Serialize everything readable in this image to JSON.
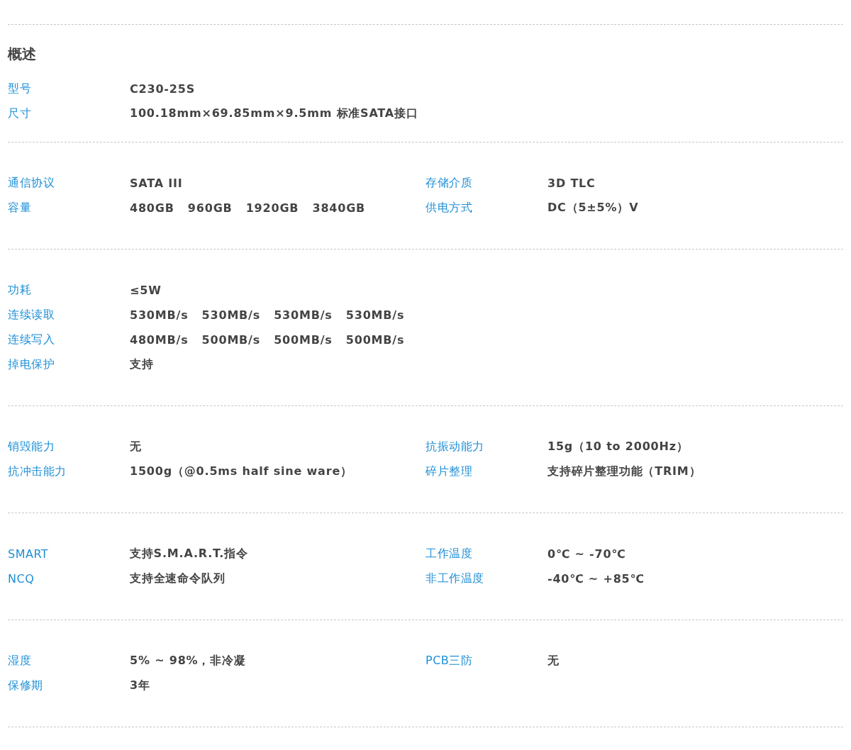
{
  "heading": "概述",
  "sections": [
    {
      "rows": [
        [
          {
            "label": "型号",
            "value": "C230-25S"
          }
        ],
        [
          {
            "label": "尺寸",
            "value": "100.18mm×69.85mm×9.5mm 标准SATA接口"
          }
        ]
      ]
    },
    {
      "rows": [
        [
          {
            "label": "通信协议",
            "value": "SATA III"
          },
          {
            "label": "存储介质",
            "value": "3D TLC"
          }
        ],
        [
          {
            "label": "容量",
            "value": "480GB   960GB   1920GB   3840GB"
          },
          {
            "label": "供电方式",
            "value": "DC（5±5%）V"
          }
        ]
      ]
    },
    {
      "rows": [
        [
          {
            "label": "功耗",
            "value": "≤5W"
          }
        ],
        [
          {
            "label": "连续读取",
            "value": "530MB/s   530MB/s   530MB/s   530MB/s"
          }
        ],
        [
          {
            "label": "连续写入",
            "value": "480MB/s   500MB/s   500MB/s   500MB/s"
          }
        ],
        [
          {
            "label": "掉电保护",
            "value": "支持"
          }
        ]
      ]
    },
    {
      "rows": [
        [
          {
            "label": "销毁能力",
            "value": "无"
          },
          {
            "label": "抗振动能力",
            "value": "15g（10 to 2000Hz）"
          }
        ],
        [
          {
            "label": "抗冲击能力",
            "value": "1500g（@0.5ms half sine ware）"
          },
          {
            "label": "碎片整理",
            "value": "支持碎片整理功能（TRIM）"
          }
        ]
      ]
    },
    {
      "rows": [
        [
          {
            "label": "SMART",
            "value": "支持S.M.A.R.T.指令"
          },
          {
            "label": "工作温度",
            "value": "0℃ ~ -70℃"
          }
        ],
        [
          {
            "label": "NCQ",
            "value": "支持全速命令队列"
          },
          {
            "label": "非工作温度",
            "value": "-40℃ ~ +85℃"
          }
        ]
      ]
    },
    {
      "rows": [
        [
          {
            "label": "湿度",
            "value": "5% ~ 98%，非冷凝"
          },
          {
            "label": "PCB三防",
            "value": "无"
          }
        ],
        [
          {
            "label": "保修期",
            "value": "3年"
          }
        ]
      ]
    }
  ]
}
